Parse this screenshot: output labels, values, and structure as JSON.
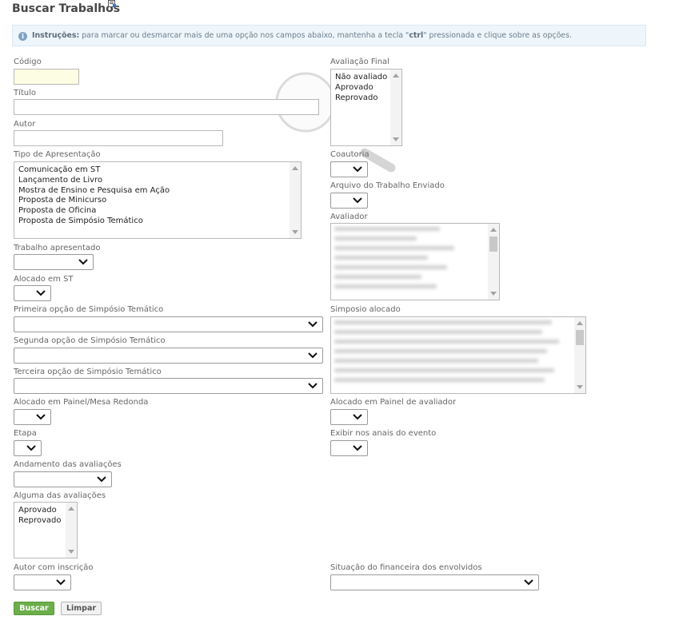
{
  "page": {
    "title": "Buscar Trabalhos"
  },
  "instructions": {
    "label": "Instruções:",
    "text_before": " para marcar ou desmarcar mais de uma opção nos campos abaixo, mantenha a tecla \"",
    "key": "ctrl",
    "text_after": "\" pressionada e clique sobre as opções."
  },
  "fields": {
    "codigo": {
      "label": "Código",
      "value": ""
    },
    "titulo": {
      "label": "Título",
      "value": ""
    },
    "autor": {
      "label": "Autor",
      "value": ""
    },
    "tipo_apresentacao": {
      "label": "Tipo de Apresentação",
      "options": [
        "Comunicação em ST",
        "Lançamento de Livro",
        "Mostra de Ensino e Pesquisa em Ação",
        "Proposta de Minicurso",
        "Proposta de Oficina",
        "Proposta de Simpósio Temático"
      ]
    },
    "trabalho_apresentado": {
      "label": "Trabalho apresentado",
      "value": ""
    },
    "alocado_st": {
      "label": "Alocado em ST",
      "value": ""
    },
    "primeira_opcao": {
      "label": "Primeira opção de Simpósio Temático",
      "value": ""
    },
    "segunda_opcao": {
      "label": "Segunda opção de Simpósio Temático",
      "value": ""
    },
    "terceira_opcao": {
      "label": "Terceira opção de Simpósio Temático",
      "value": ""
    },
    "alocado_painel": {
      "label": "Alocado em Painel/Mesa Redonda",
      "value": ""
    },
    "etapa": {
      "label": "Etapa",
      "value": ""
    },
    "andamento": {
      "label": "Andamento das avaliações",
      "value": ""
    },
    "alguma_avaliacao": {
      "label": "Alguma das avaliações",
      "options": [
        "Aprovado",
        "Reprovado"
      ]
    },
    "autor_inscricao": {
      "label": "Autor com inscrição",
      "value": ""
    },
    "avaliacao_final": {
      "label": "Avaliação Final",
      "options": [
        "Não avaliado",
        "Aprovado",
        "Reprovado"
      ]
    },
    "coautoria": {
      "label": "Coautoria",
      "value": ""
    },
    "arquivo_enviado": {
      "label": "Arquivo do Trabalho Enviado",
      "value": ""
    },
    "avaliador": {
      "label": "Avaliador"
    },
    "simposio_alocado": {
      "label": "Simposio alocado"
    },
    "alocado_painel_avaliador": {
      "label": "Alocado em Painel de avaliador",
      "value": ""
    },
    "exibir_anais": {
      "label": "Exibir nos anais do evento",
      "value": ""
    },
    "situacao_financeira": {
      "label": "Situação do financeira dos envolvidos",
      "value": ""
    }
  },
  "buttons": {
    "search": "Buscar",
    "clear": "Limpar"
  },
  "icons": {
    "info": "info-icon",
    "chevron": "chevron-down-icon",
    "title_badge": "edit-icon"
  },
  "colors": {
    "primary_button": "#6cae4a",
    "highlight_input": "#fdfde3",
    "info_bg": "#eef6fc"
  }
}
